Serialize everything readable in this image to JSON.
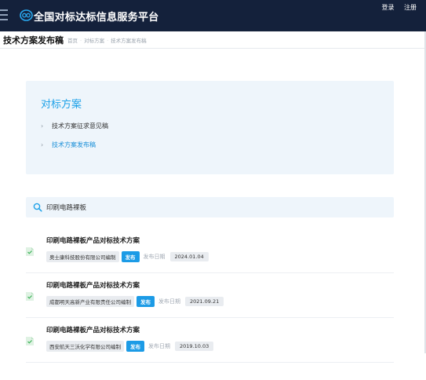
{
  "header": {
    "site_title": "全国对标达标信息服务平台",
    "login_label": "登录",
    "register_label": "注册"
  },
  "subheader": {
    "page_title": "技术方案发布稿",
    "breadcrumb": [
      "首页",
      "对标方案",
      "技术方案发布稿"
    ]
  },
  "panel": {
    "title": "对标方案",
    "items": [
      {
        "label": "技术方案征求意见稿",
        "active": false
      },
      {
        "label": "技术方案发布稿",
        "active": true
      }
    ]
  },
  "search": {
    "value": "印刷电路裸板"
  },
  "results": [
    {
      "title": "印刷电路裸板产品对标技术方案",
      "org": "奥士康科技股份有限公司编制",
      "status": "发布",
      "date_label": "发布日期",
      "date": "2024.01.04"
    },
    {
      "title": "印刷电路裸板产品对标技术方案",
      "org": "成都明天高新产业有限责任公司编制",
      "status": "发布",
      "date_label": "发布日期",
      "date": "2021.09.21"
    },
    {
      "title": "印刷电路裸板产品对标技术方案",
      "org": "西安航天三沃化学有限公司编制",
      "status": "发布",
      "date_label": "发布日期",
      "date": "2019.10.03"
    }
  ],
  "colors": {
    "header_bg": "#14213b",
    "accent": "#1da1e8",
    "badge": "#1c9be6",
    "panel_bg": "#eef5fb"
  },
  "icons": {
    "menu": "menu-icon",
    "logo": "logo-icon",
    "chevron": "chevron-right-icon",
    "search": "search-icon",
    "document": "document-icon"
  }
}
